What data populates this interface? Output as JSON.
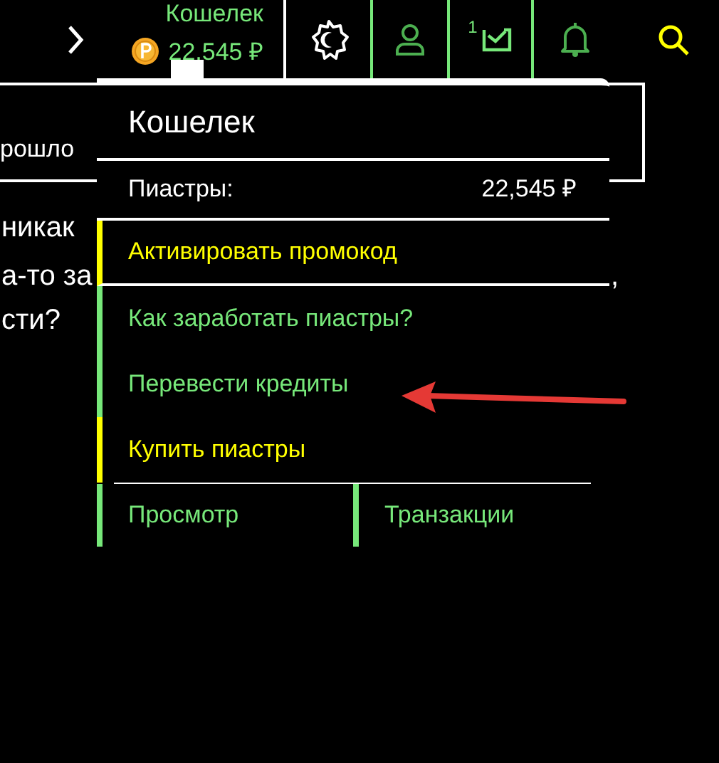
{
  "top_bar": {
    "wallet": {
      "label": "Кошелек",
      "balance": "22,545 ₽"
    },
    "mail_badge": "1"
  },
  "background_text": [
    {
      "text": "рошло",
      "kind": "boxed"
    },
    {
      "text": "никак",
      "kind": "line"
    },
    {
      "text": "а-то за",
      "kind": "line"
    },
    {
      "text": "сти?",
      "kind": "line"
    },
    {
      "text": ",",
      "kind": "right"
    }
  ],
  "wallet_popup": {
    "title": "Кошелек",
    "balance_label": "Пиастры:",
    "balance_value": "22,545 ₽",
    "items": [
      {
        "label": "Активировать промокод",
        "color": "#ffff00"
      },
      {
        "label": "Как заработать пиастры?",
        "color": "#77e87a"
      },
      {
        "label": "Перевести кредиты",
        "color": "#77e87a"
      },
      {
        "label": "Купить пиастры",
        "color": "#ffff00"
      }
    ],
    "footer_tabs": [
      {
        "label": "Просмотр",
        "color": "#77e87a"
      },
      {
        "label": "Транзакции",
        "color": "#77e87a"
      }
    ]
  }
}
